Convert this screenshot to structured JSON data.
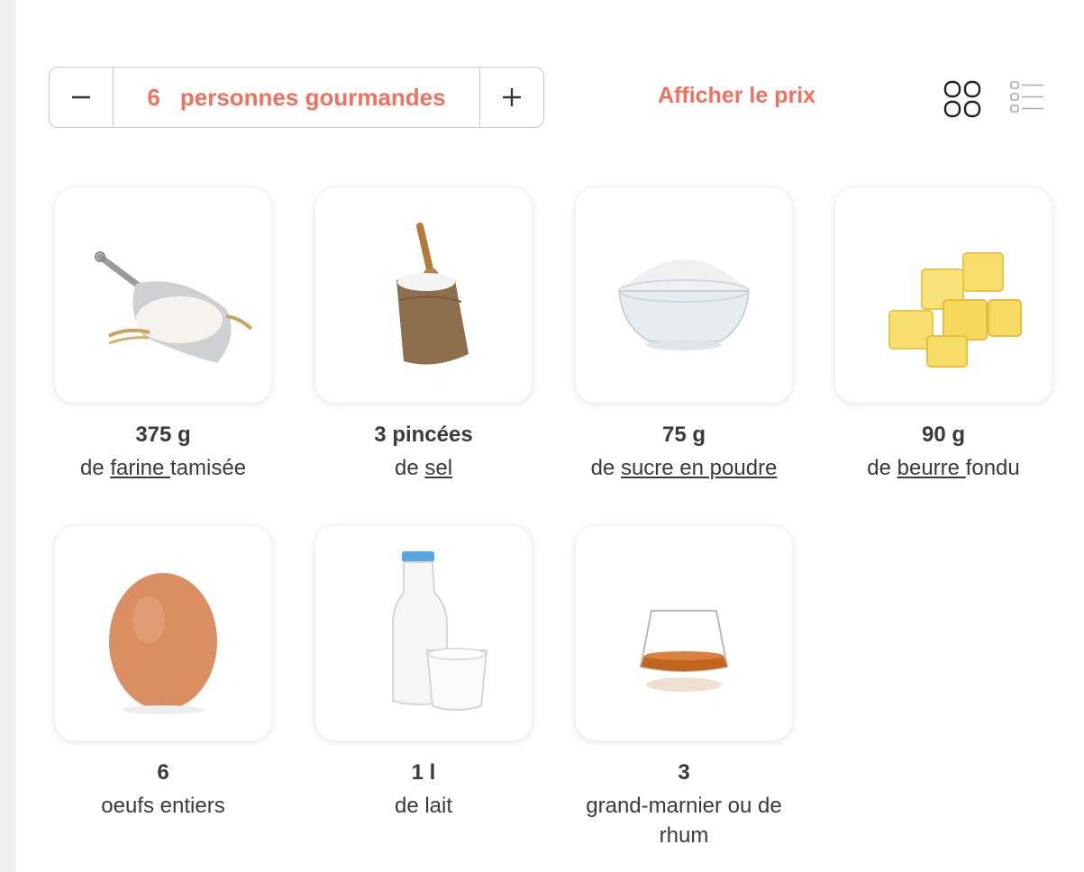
{
  "servings": {
    "count": "6",
    "label": "personnes gourmandes"
  },
  "price_link": "Afficher le prix",
  "ingredients": [
    {
      "qty": "375 g",
      "pre": "de ",
      "link": "farine ",
      "post": "tamisée",
      "icon": "flour-icon"
    },
    {
      "qty": "3 pincées",
      "pre": "de ",
      "link": "sel",
      "post": "",
      "icon": "salt-sack-icon"
    },
    {
      "qty": "75 g",
      "pre": "de ",
      "link": "sucre en poudre",
      "post": "",
      "icon": "sugar-bowl-icon"
    },
    {
      "qty": "90 g",
      "pre": "de ",
      "link": "beurre ",
      "post": "fondu",
      "icon": "butter-icon"
    },
    {
      "qty": "6",
      "pre": "oeufs entiers",
      "link": "",
      "post": "",
      "icon": "egg-icon"
    },
    {
      "qty": "1 l",
      "pre": "de lait",
      "link": "",
      "post": "",
      "icon": "milk-icon"
    },
    {
      "qty": "3",
      "pre": "grand-marnier ou de rhum",
      "link": "",
      "post": "",
      "icon": "liqueur-glass-icon"
    }
  ]
}
